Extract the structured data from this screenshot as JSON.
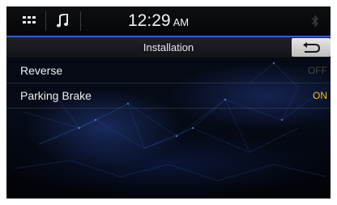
{
  "status_bar": {
    "menu_icon": "grid-menu-icon",
    "audio_source_icon": "music-note-icon",
    "time": "12:29",
    "ampm": "AM",
    "right_icon": "bluetooth-icon"
  },
  "title_bar": {
    "title": "Installation",
    "back_icon": "return-arrow-icon"
  },
  "settings": [
    {
      "label": "Reverse",
      "value": "OFF",
      "state_color": "#44474c"
    },
    {
      "label": "Parking Brake",
      "value": "ON",
      "state_color": "#f0c419"
    }
  ],
  "colors": {
    "accent_line": "#2b5fd8",
    "on_value": "#f0c419",
    "off_value": "#44474c"
  }
}
